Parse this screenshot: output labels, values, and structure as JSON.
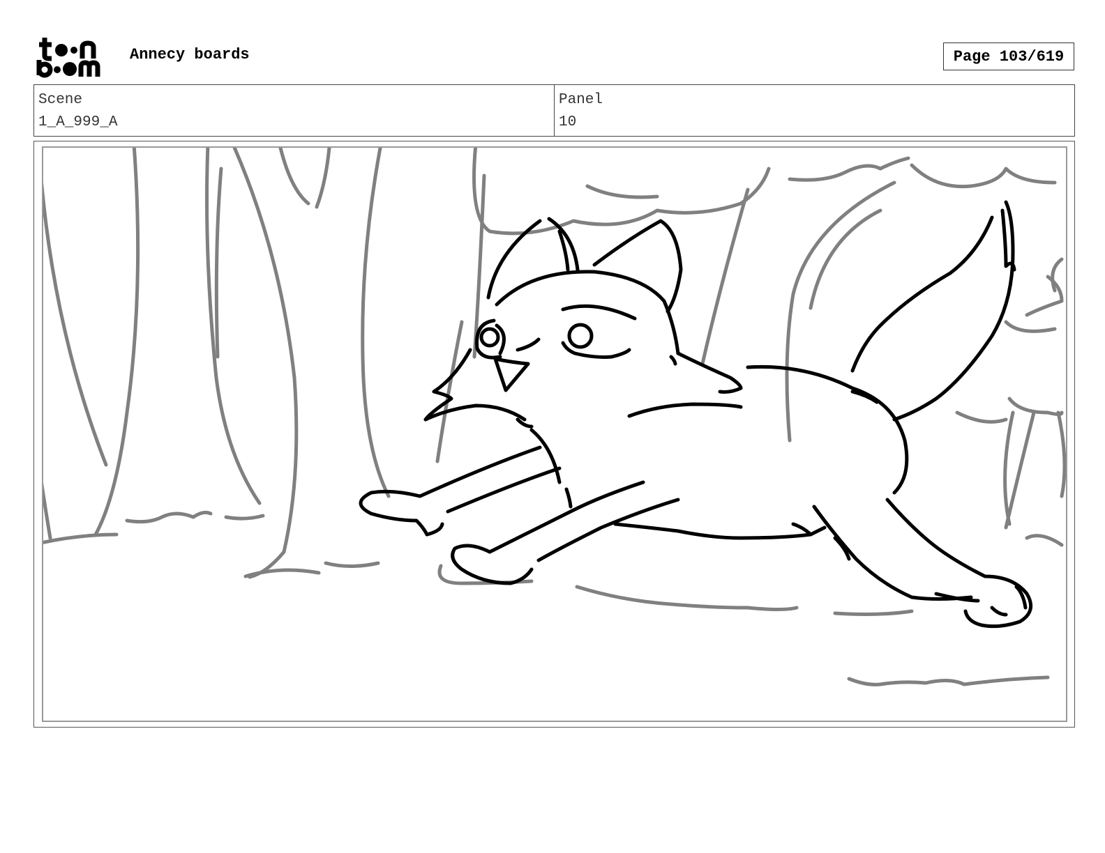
{
  "header": {
    "logo_text_top": "toon",
    "logo_text_bottom": "boom",
    "project_title": "Annecy boards",
    "page_indicator": "Page 103/619"
  },
  "info": {
    "scene_label": "Scene",
    "scene_value": "1_A_999_A",
    "panel_label": "Panel",
    "panel_value": "10"
  },
  "panel_image": {
    "subject": "fox-running-in-forest",
    "line_color_main": "#000000",
    "line_color_background": "#808080"
  }
}
